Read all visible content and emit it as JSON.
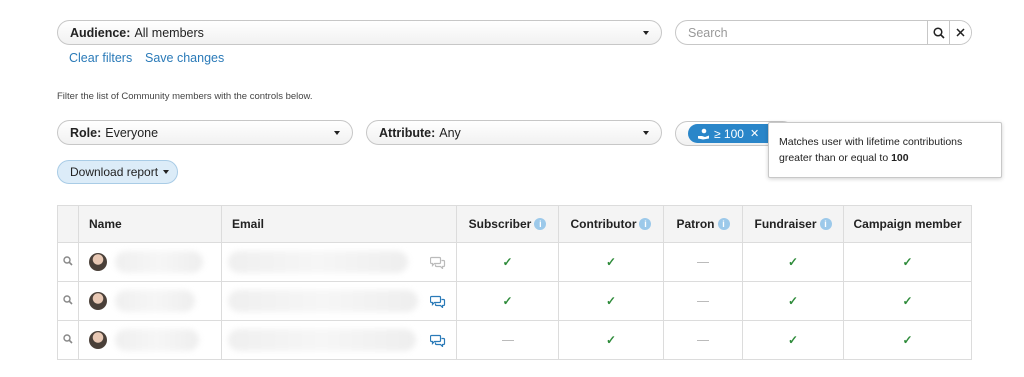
{
  "filters": {
    "audience_label": "Audience:",
    "audience_value": "All members",
    "clear_filters": "Clear filters",
    "save_changes": "Save changes",
    "help_text": "Filter the list of Community members with the controls below.",
    "role_label": "Role:",
    "role_value": "Everyone",
    "attribute_label": "Attribute:",
    "attribute_value": "Any",
    "chip_value": "≥ 100",
    "chip_icon": "hand-coin-icon"
  },
  "search": {
    "placeholder": "Search"
  },
  "tooltip": {
    "text_line1": "Matches user with lifetime contributions",
    "text_line2_prefix": "greater than or equal to ",
    "text_value": "100"
  },
  "download_label": "Download report",
  "table": {
    "columns": [
      "Name",
      "Email",
      "Subscriber",
      "Contributor",
      "Patron",
      "Fundraiser",
      "Campaign member"
    ],
    "rows": [
      {
        "chat_active": false,
        "subscriber": true,
        "contributor": true,
        "patron": false,
        "fundraiser": true,
        "campaign_member": true
      },
      {
        "chat_active": true,
        "subscriber": true,
        "contributor": true,
        "patron": false,
        "fundraiser": true,
        "campaign_member": true
      },
      {
        "chat_active": true,
        "subscriber": false,
        "contributor": true,
        "patron": false,
        "fundraiser": true,
        "campaign_member": true
      }
    ]
  },
  "colors": {
    "link": "#2a7ab8",
    "check": "#2e8b3a",
    "chip": "#2a86c9",
    "info": "#9cc9ea"
  }
}
